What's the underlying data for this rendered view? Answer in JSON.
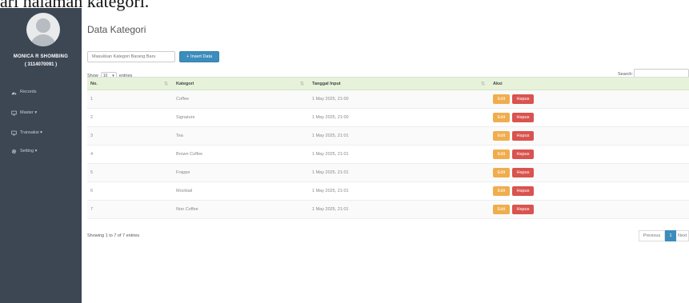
{
  "caption": "ari halaman kategori.",
  "sidebar": {
    "user_name": "MONICA R SHOMBING",
    "user_id": "( 3114070091 )",
    "items": [
      {
        "label": "Records",
        "icon": "dashboard-icon"
      },
      {
        "label": "Master ▾",
        "icon": "monitor-icon"
      },
      {
        "label": "Transaksi ▾",
        "icon": "monitor-icon"
      },
      {
        "label": "Setting ▾",
        "icon": "gear-icon"
      }
    ]
  },
  "page": {
    "title": "Data Kategori",
    "input_placeholder": "Masukkan Kategori Barang Baru",
    "insert_label": "Insert Data",
    "show_label": "Show",
    "entries_value": "10",
    "entries_label": "entries",
    "search_label": "Search:"
  },
  "table": {
    "headers": [
      "No.",
      "Kategori",
      "Tanggal Input",
      "Aksi"
    ],
    "rows": [
      {
        "no": "1",
        "kategori": "Coffee",
        "tanggal": "1 May 2025, 21:00"
      },
      {
        "no": "2",
        "kategori": "Signature",
        "tanggal": "1 May 2025, 21:00"
      },
      {
        "no": "3",
        "kategori": "Tea",
        "tanggal": "1 May 2025, 21:01"
      },
      {
        "no": "4",
        "kategori": "Brown Coffee",
        "tanggal": "1 May 2025, 21:01"
      },
      {
        "no": "5",
        "kategori": "Frappe",
        "tanggal": "1 May 2025, 21:01"
      },
      {
        "no": "6",
        "kategori": "Mocktail",
        "tanggal": "1 May 2025, 21:01"
      },
      {
        "no": "7",
        "kategori": "Non Coffee",
        "tanggal": "1 May 2025, 21:01"
      }
    ],
    "edit_label": "Edit",
    "delete_label": "Hapus"
  },
  "footer": {
    "info": "Showing 1 to 7 of 7 entries",
    "prev": "Previous",
    "page": "1",
    "next": "Next"
  },
  "colors": {
    "sidebar": "#3d4653",
    "primary": "#3c8dbc",
    "edit": "#f0ad4e",
    "delete": "#d9534f",
    "header_row": "#e6f2da"
  }
}
